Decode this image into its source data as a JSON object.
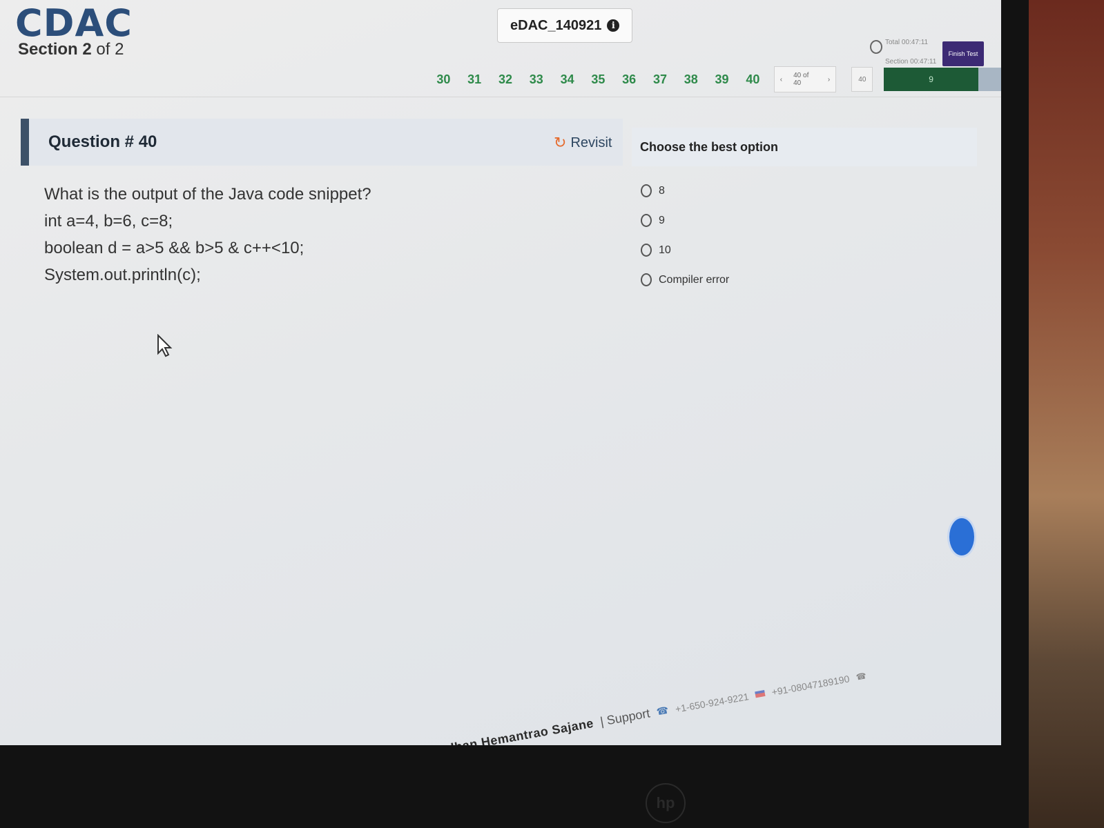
{
  "header": {
    "logo": "CDAC",
    "section_prefix": "Section",
    "section_current": "2",
    "section_of": "of 2",
    "candidate_id": "eDAC_140921",
    "timer_total": "Total 00:47:11",
    "timer_section": "Section 00:47:11",
    "finish_label": "Finish Test"
  },
  "question_nav": {
    "numbers": [
      "30",
      "31",
      "32",
      "33",
      "34",
      "35",
      "36",
      "37",
      "38",
      "39",
      "40"
    ],
    "prev": "‹",
    "page_status": "40 of 40",
    "next": "›",
    "go_label": "40",
    "progress_label": "9"
  },
  "question": {
    "title": "Question # 40",
    "revisit_label": "Revisit",
    "lines": [
      "What is the output of the Java code snippet?",
      "int a=4, b=6, c=8;",
      "boolean d = a>5 && b>5 & c++<10;",
      "System.out.println(c);"
    ]
  },
  "options_panel": {
    "title": "Choose the best option",
    "options": [
      "8",
      "9",
      "10",
      "Compiler error"
    ]
  },
  "footer": {
    "name": "Adityavardhan Hemantrao Sajane",
    "support_label": "| Support",
    "phone_primary": "+1-650-924-9221",
    "phone_secondary": "+91-08047189190"
  }
}
